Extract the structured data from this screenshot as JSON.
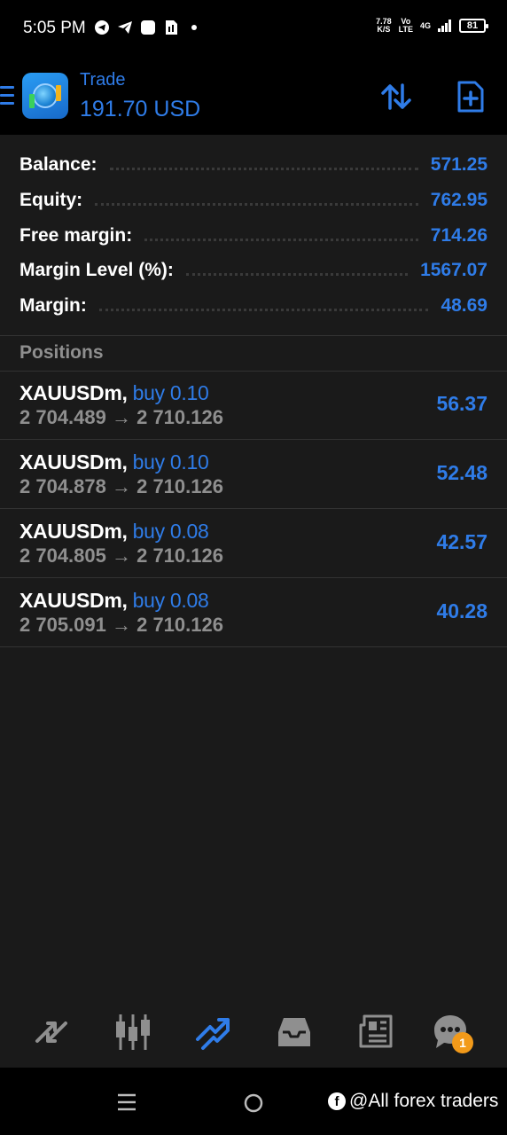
{
  "status": {
    "time": "5:05 PM",
    "net_speed_value": "7.78",
    "net_speed_unit": "K/S",
    "volte_top": "Vo",
    "volte_bottom": "LTE",
    "network_type": "4G",
    "battery": "81"
  },
  "header": {
    "title": "Trade",
    "subtitle": "191.70 USD"
  },
  "summary": [
    {
      "label": "Balance:",
      "value": "571.25"
    },
    {
      "label": "Equity:",
      "value": "762.95"
    },
    {
      "label": "Free margin:",
      "value": "714.26"
    },
    {
      "label": "Margin Level (%):",
      "value": "1567.07"
    },
    {
      "label": "Margin:",
      "value": "48.69"
    }
  ],
  "positions_title": "Positions",
  "positions": [
    {
      "symbol": "XAUUSDm,",
      "side": "buy 0.10",
      "prices": "2 704.489 → 2 710.126",
      "profit": "56.37"
    },
    {
      "symbol": "XAUUSDm,",
      "side": "buy 0.10",
      "prices": "2 704.878 → 2 710.126",
      "profit": "52.48"
    },
    {
      "symbol": "XAUUSDm,",
      "side": "buy 0.08",
      "prices": "2 704.805 → 2 710.126",
      "profit": "42.57"
    },
    {
      "symbol": "XAUUSDm,",
      "side": "buy 0.08",
      "prices": "2 705.091 → 2 710.126",
      "profit": "40.28"
    }
  ],
  "tabs": [
    {
      "icon": "quotes-icon",
      "active": false
    },
    {
      "icon": "chart-icon",
      "active": false
    },
    {
      "icon": "trade-icon",
      "active": true
    },
    {
      "icon": "history-icon",
      "active": false
    },
    {
      "icon": "news-icon",
      "active": false
    },
    {
      "icon": "messages-icon",
      "active": false
    }
  ],
  "messages_badge": "1",
  "watermark": "@All forex traders",
  "colors": {
    "accent": "#2f7ce8",
    "background": "#1a1a1a",
    "muted": "#8f8f8f",
    "badge": "#f29a1a"
  }
}
